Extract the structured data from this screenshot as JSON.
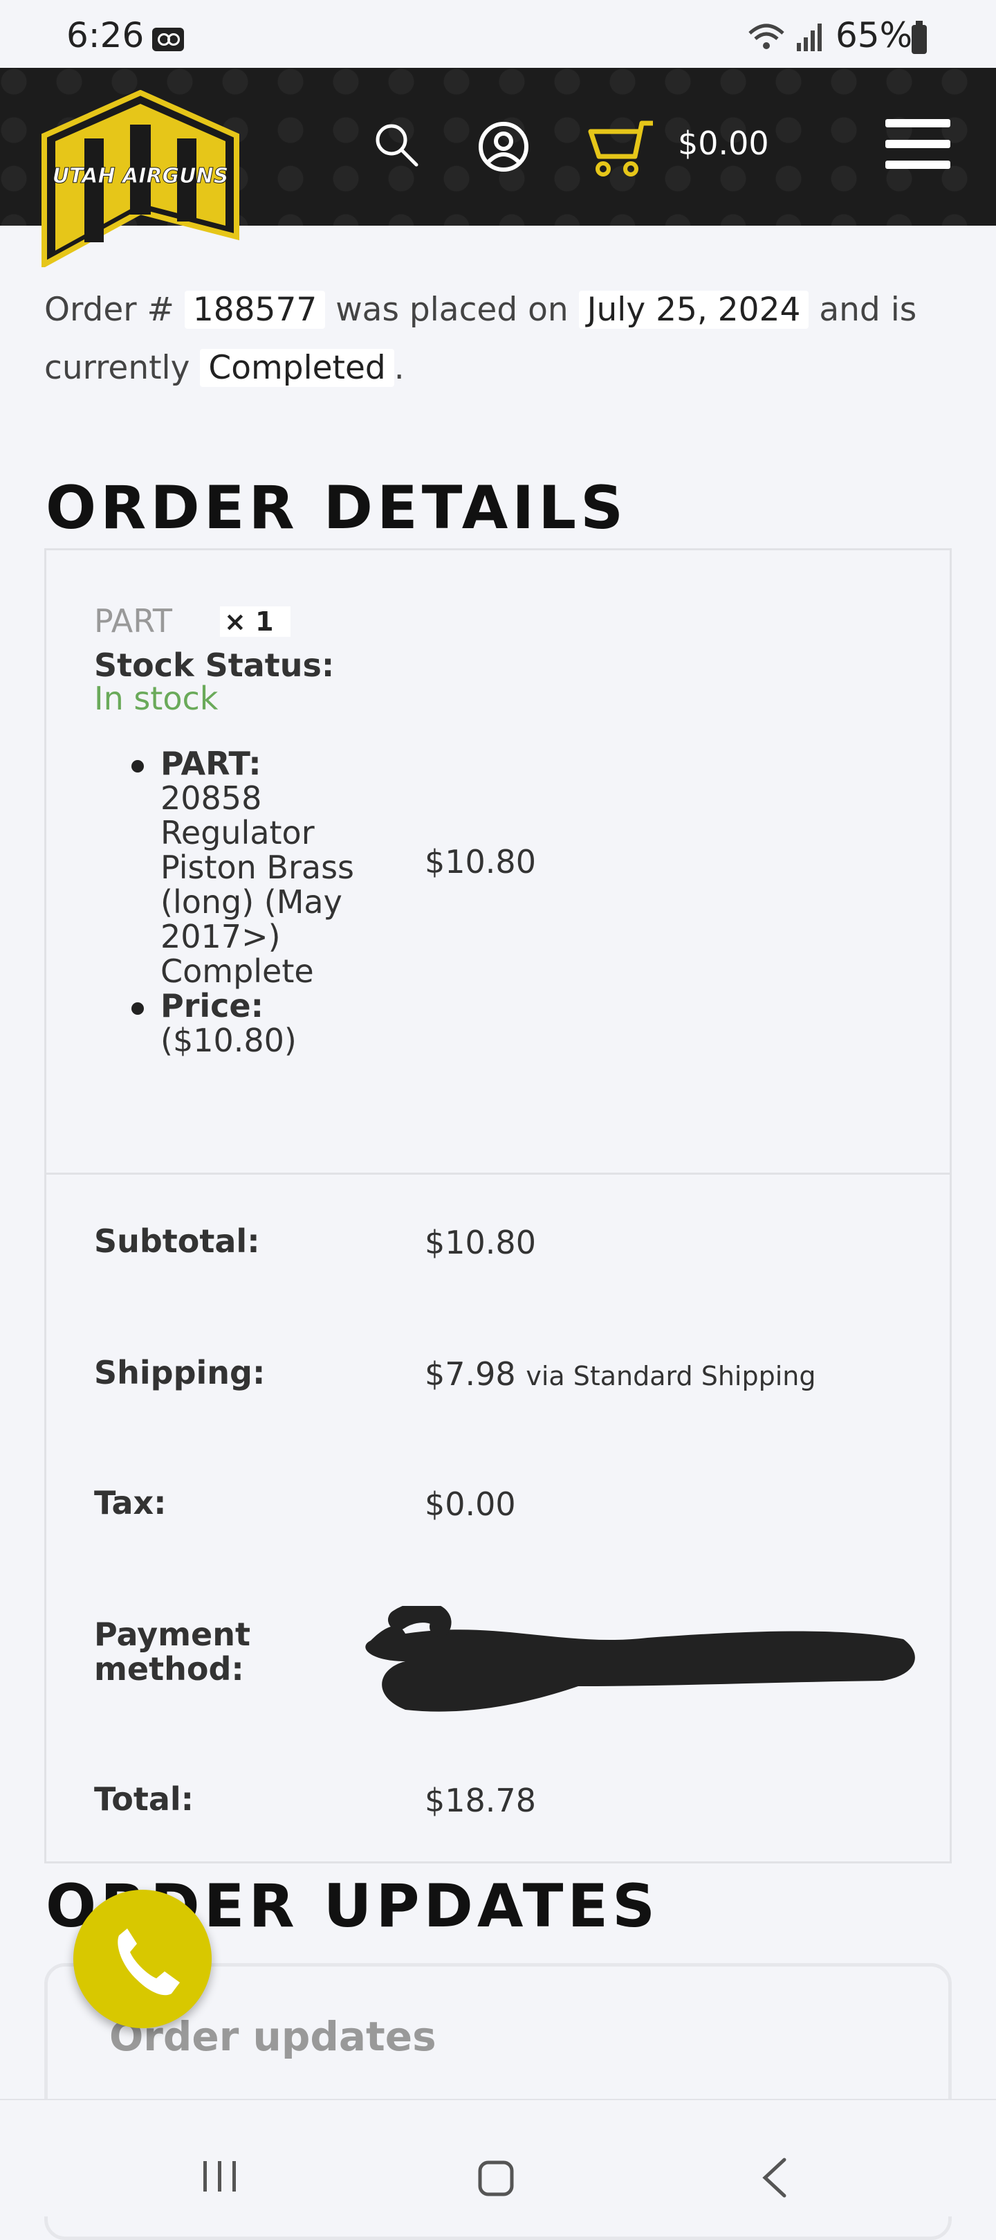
{
  "status_bar": {
    "time": "6:26",
    "battery": "65%",
    "icons": [
      "voicemail-icon",
      "wifi-icon",
      "signal-icon",
      "battery-icon"
    ]
  },
  "header": {
    "logo_text": "UTAH AIRGUNS",
    "cart_total": "$0.00",
    "icons": [
      "search-icon",
      "account-icon",
      "cart-icon",
      "menu-icon"
    ],
    "accent_color": "#e6c619"
  },
  "order": {
    "prefix": "Order #",
    "number": "188577",
    "placed_text": "was placed on",
    "date": "July 25, 2024",
    "and_is": "and is",
    "currently": "currently",
    "status": "Completed",
    "period": "."
  },
  "details": {
    "heading": "ORDER DETAILS",
    "item": {
      "name": "PART",
      "qty": "× 1",
      "stock_label": "Stock Status:",
      "stock_value": "In stock",
      "meta": [
        {
          "label": "PART:",
          "value": "20858 Regulator Piston Brass (long) (May 2017>) Complete"
        },
        {
          "label": "Price:",
          "value": "($10.80)"
        }
      ],
      "line_total": "$10.80"
    },
    "totals": [
      {
        "label": "Subtotal:",
        "value": "$10.80",
        "note": ""
      },
      {
        "label": "Shipping:",
        "value": "$7.98",
        "note": "via Standard Shipping"
      },
      {
        "label": "Tax:",
        "value": "$0.00",
        "note": ""
      },
      {
        "label": "Payment method:",
        "value": "",
        "note": ""
      },
      {
        "label": "Total:",
        "value": "$18.78",
        "note": ""
      }
    ]
  },
  "updates": {
    "heading": "ORDER UPDATES",
    "box_title": "Order updates"
  },
  "nav": {
    "icons": [
      "recent-apps-icon",
      "home-icon",
      "back-icon"
    ]
  }
}
